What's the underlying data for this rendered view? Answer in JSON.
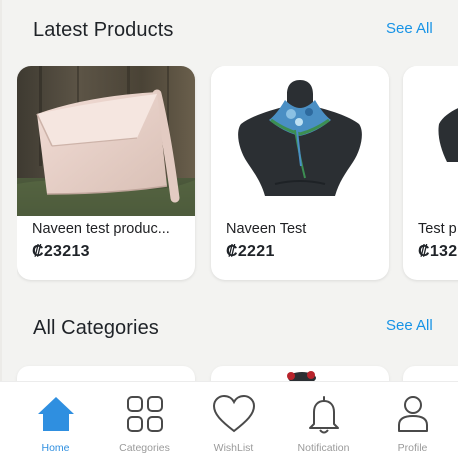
{
  "sections": {
    "latest_products": {
      "title": "Latest Products",
      "see_all": "See All"
    },
    "all_categories": {
      "title": "All Categories",
      "see_all": "See All"
    }
  },
  "products": [
    {
      "name": "Naveen test produc...",
      "price": "₡23213",
      "image": "pink-leather-bag"
    },
    {
      "name": "Naveen Test",
      "price": "₡2221",
      "image": "mannequin-scarf"
    },
    {
      "name": "Test p",
      "price": "₡132",
      "image": "mannequin-partial"
    }
  ],
  "bottom_nav": [
    {
      "label": "Home",
      "icon": "home-icon",
      "active": true
    },
    {
      "label": "Categories",
      "icon": "grid-icon",
      "active": false
    },
    {
      "label": "WishList",
      "icon": "heart-icon",
      "active": false
    },
    {
      "label": "Notification",
      "icon": "bell-icon",
      "active": false
    },
    {
      "label": "Profile",
      "icon": "user-icon",
      "active": false
    }
  ],
  "colors": {
    "accent": "#2f8fe0",
    "link": "#1793e6",
    "background": "#f3f3f1"
  }
}
